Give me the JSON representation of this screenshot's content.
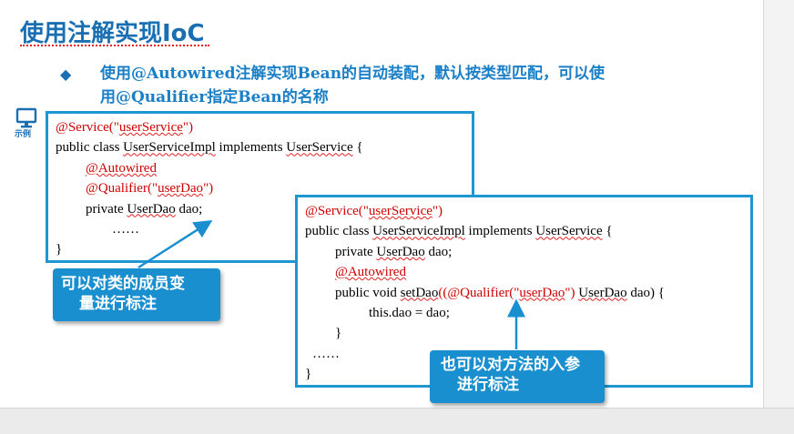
{
  "title": "使用注解实现IoC",
  "bullet": {
    "marker": "◆",
    "text_line1": "使用@Autowired注解实现Bean的自动装配，默认按类型匹配，可以使",
    "text_line2": "用@Qualifier指定Bean的名称"
  },
  "example": {
    "icon": "monitor-icon",
    "label": "示例"
  },
  "code1": {
    "l1_a": "@Service(\"",
    "l1_b": "userService",
    "l1_c": "\")",
    "l2_a": "public class ",
    "l2_b": "UserServiceImpl",
    "l2_c": " implements ",
    "l2_d": "UserService",
    "l2_e": " {",
    "l3": "@Autowired",
    "l4_a": "@Qualifier(\"",
    "l4_b": "userDao",
    "l4_c": "\")",
    "l5_a": "private ",
    "l5_b": "UserDao",
    "l5_c": " dao;",
    "l6": "……",
    "l7": "}"
  },
  "code2": {
    "l1_a": "@Service(\"",
    "l1_b": "userService",
    "l1_c": "\")",
    "l2_a": "public class ",
    "l2_b": "UserServiceImpl",
    "l2_c": " implements ",
    "l2_d": "UserService",
    "l2_e": " {",
    "l3_a": "private ",
    "l3_b": "UserDao",
    "l3_c": " dao;",
    "l4": "@Autowired",
    "l5_a": "public void ",
    "l5_b": "setDao",
    "l5_c": "((@Qualifier(\"",
    "l5_d": "userDao",
    "l5_e": "\") ",
    "l5_f": "UserDao",
    "l5_g": " dao) {",
    "l6": "this.dao = dao;",
    "l7": "}",
    "l8": "……",
    "l9": "}"
  },
  "callout1": {
    "line1": "可以对类的成员变",
    "line2": "量进行标注"
  },
  "callout2": {
    "line1": "也可以对方法的入参",
    "line2": "进行标注"
  },
  "colors": {
    "title": "#1a6fb3",
    "bullet_text": "#1a7fc6",
    "code_border": "#1e96d2",
    "annotation": "#d00000",
    "callout_bg": "#1a8fd0"
  }
}
